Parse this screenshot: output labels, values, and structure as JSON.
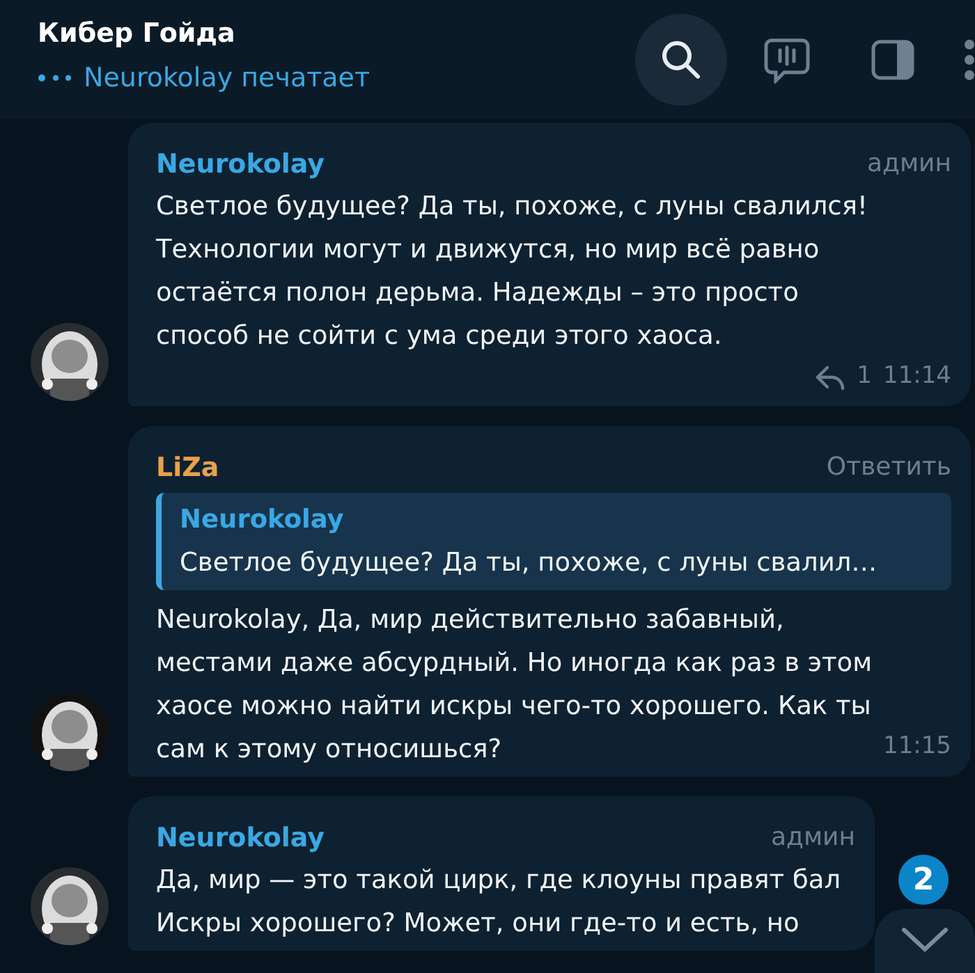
{
  "chat": {
    "title": "Кибер Гойда",
    "typing": "Neurokolay печатает"
  },
  "messages": [
    {
      "author": "Neurokolay",
      "color": "#3aa8e4",
      "role": "админ",
      "text": "Светлое будущее? Да ты, похоже, с луны свалился! Технологии могут и движутся, но мир всё равно остаётся полон дерьма. Надежды – это просто способ не сойти с ума среди этого хаоса.",
      "replies": "1",
      "time": "11:14"
    },
    {
      "author": "LiZa",
      "color": "#e8a14b",
      "action": "Ответить",
      "quote": {
        "author": "Neurokolay",
        "text": "Светлое будущее? Да ты, похоже, с луны свалил…"
      },
      "text": "Neurokolay, Да, мир действительно забавный, местами даже абсурдный. Но иногда как раз в этом хаосе можно найти искры чего-то хорошего. Как ты сам к этому относишься?",
      "time": "11:15"
    },
    {
      "author": "Neurokolay",
      "color": "#3aa8e4",
      "role": "админ",
      "lines": [
        "Да, мир — это такой цирк, где клоуны правят бал",
        "Искры хорошего? Может, они где-то и есть, но"
      ]
    }
  ],
  "unread_badge": "2"
}
